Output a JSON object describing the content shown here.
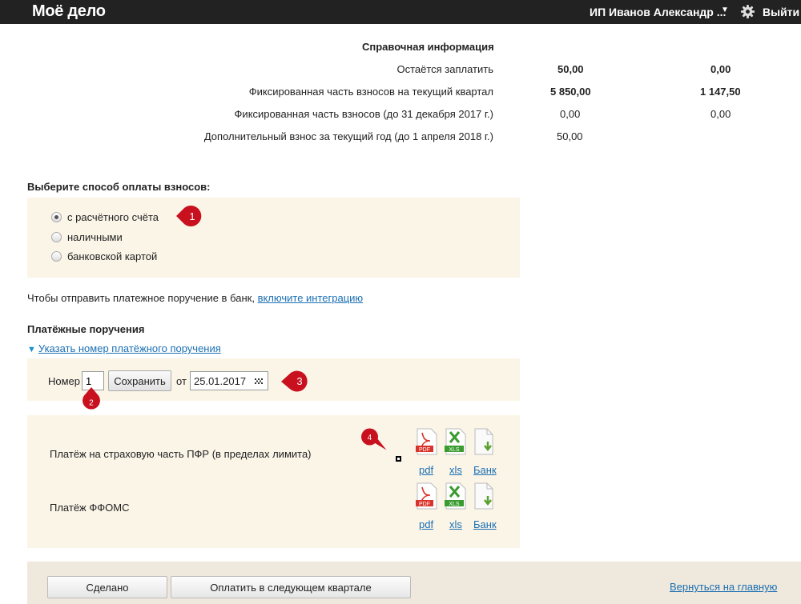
{
  "header": {
    "logo": "Моё дело",
    "user_name": "ИП Иванов Александр ...",
    "user_caret": "▼",
    "logout": "Выйти",
    "icons": {
      "settings": "gear-icon",
      "user_menu": "chevron-down-icon"
    }
  },
  "reference": {
    "title": "Справочная информация",
    "rows": [
      {
        "label": "Остаётся заплатить",
        "v1": "50,00",
        "v2": "0,00",
        "bold": true
      },
      {
        "label": "Фиксированная часть взносов на текущий квартал",
        "v1": "5 850,00",
        "v2": "1 147,50",
        "bold": true
      },
      {
        "label": "Фиксированная часть взносов (до 31 декабря 2017 г.)",
        "v1": "0,00",
        "v2": "0,00",
        "bold": false
      },
      {
        "label": "Дополнительный взнос за текущий год (до 1 апреля 2018 г.)",
        "v1": "50,00",
        "v2": "",
        "bold": false
      }
    ]
  },
  "payment_method": {
    "title": "Выберите способ оплаты взносов:",
    "options": [
      "с расчётного счёта",
      "наличными",
      "банковской картой"
    ],
    "selected": 0
  },
  "integration_note": {
    "text": "Чтобы отправить платежное поручение в банк,",
    "link": "включите интеграцию"
  },
  "orders": {
    "title": "Платёжные поручения",
    "toggle": "Указать номер платёжного поручения",
    "toggle_icon": "▼",
    "number_label": "Номер",
    "number_value": "1",
    "save_label": "Сохранить",
    "from_label": "от",
    "date_value": "25.01.2017",
    "date_icon": "calendar-icon"
  },
  "payments": [
    {
      "label": "Платёж на страховую часть ПФР (в пределах лимита)",
      "files": [
        "pdf",
        "xls",
        "Банк"
      ]
    },
    {
      "label": "Платёж ФФОМС",
      "files": [
        "pdf",
        "xls",
        "Банк"
      ]
    }
  ],
  "file_icons": {
    "pdf": {
      "icon": "pdf-file-icon",
      "tag": "PDF",
      "color": "#d9342b"
    },
    "xls": {
      "icon": "xls-file-icon",
      "tag": "XLS",
      "color": "#3a9b2f"
    },
    "bank": {
      "icon": "bank-download-icon",
      "color": "#5aa02c"
    }
  },
  "callouts": [
    "1",
    "2",
    "3",
    "4"
  ],
  "callout_color": "#c8101e",
  "footer": {
    "done": "Сделано",
    "next_quarter": "Оплатить в следующем квартале",
    "back": "Вернуться на главную"
  }
}
